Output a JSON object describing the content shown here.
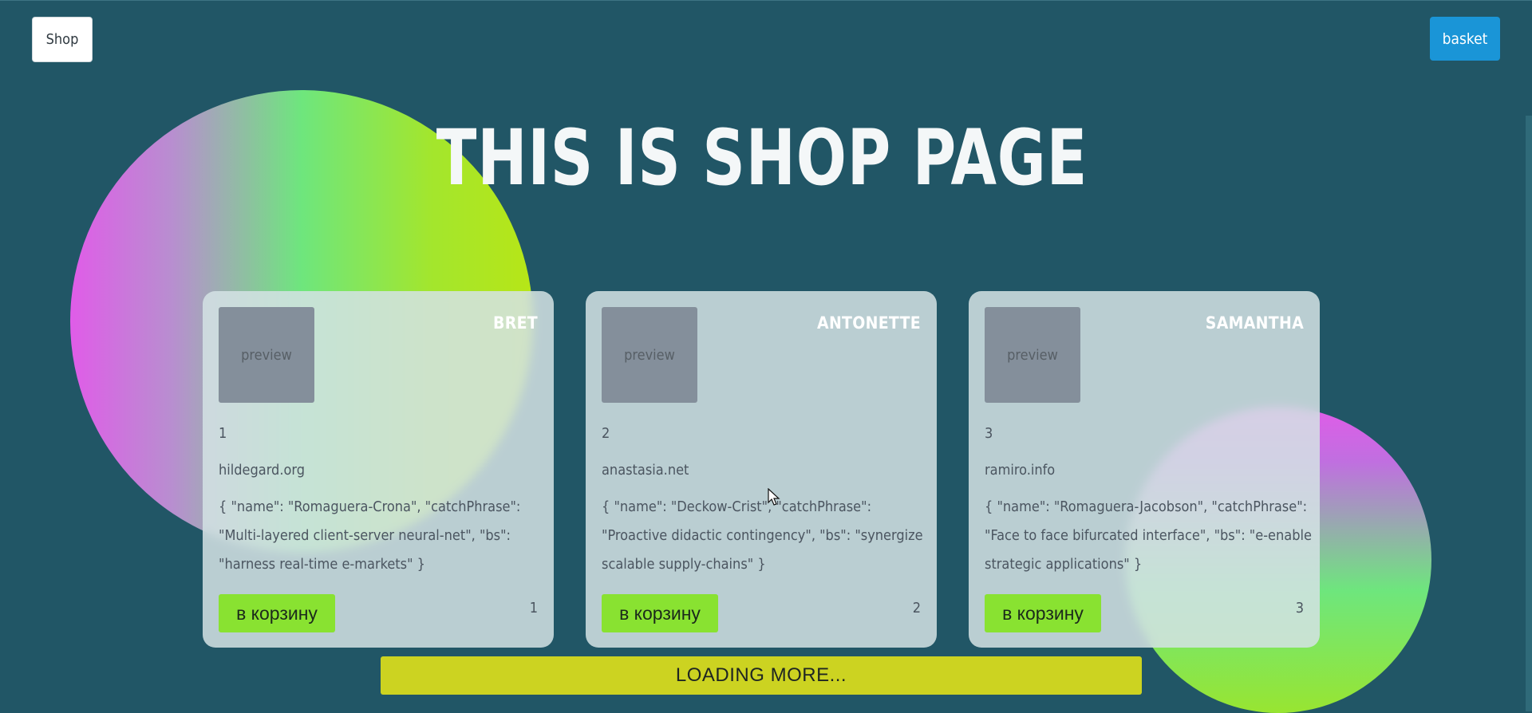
{
  "header": {
    "shop_label": "Shop",
    "basket_label": "basket",
    "title": "THIS IS SHOP PAGE"
  },
  "cards": [
    {
      "preview": "preview",
      "name": "Bret",
      "id": "1",
      "website": "hildegard.org",
      "company": "{ \"name\": \"Romaguera-Crona\", \"catchPhrase\": \"Multi-layered client-server neural-net\", \"bs\": \"harness real-time e-markets\" }",
      "button": "в корзину",
      "count": "1"
    },
    {
      "preview": "preview",
      "name": "Antonette",
      "id": "2",
      "website": "anastasia.net",
      "company": "{ \"name\": \"Deckow-Crist\", \"catchPhrase\": \"Proactive didactic contingency\", \"bs\": \"synergize scalable supply-chains\" }",
      "button": "в корзину",
      "count": "2"
    },
    {
      "preview": "preview",
      "name": "Samantha",
      "id": "3",
      "website": "ramiro.info",
      "company": "{ \"name\": \"Romaguera-Jacobson\", \"catchPhrase\": \"Face to face bifurcated interface\", \"bs\": \"e-enable strategic applications\" }",
      "button": "в корзину",
      "count": "3"
    }
  ],
  "load_more": "LOADING MORE...",
  "colors": {
    "background": "#215666",
    "basket_button": "#1a95d7",
    "add_button": "#89e231",
    "load_more": "#ccd321"
  }
}
